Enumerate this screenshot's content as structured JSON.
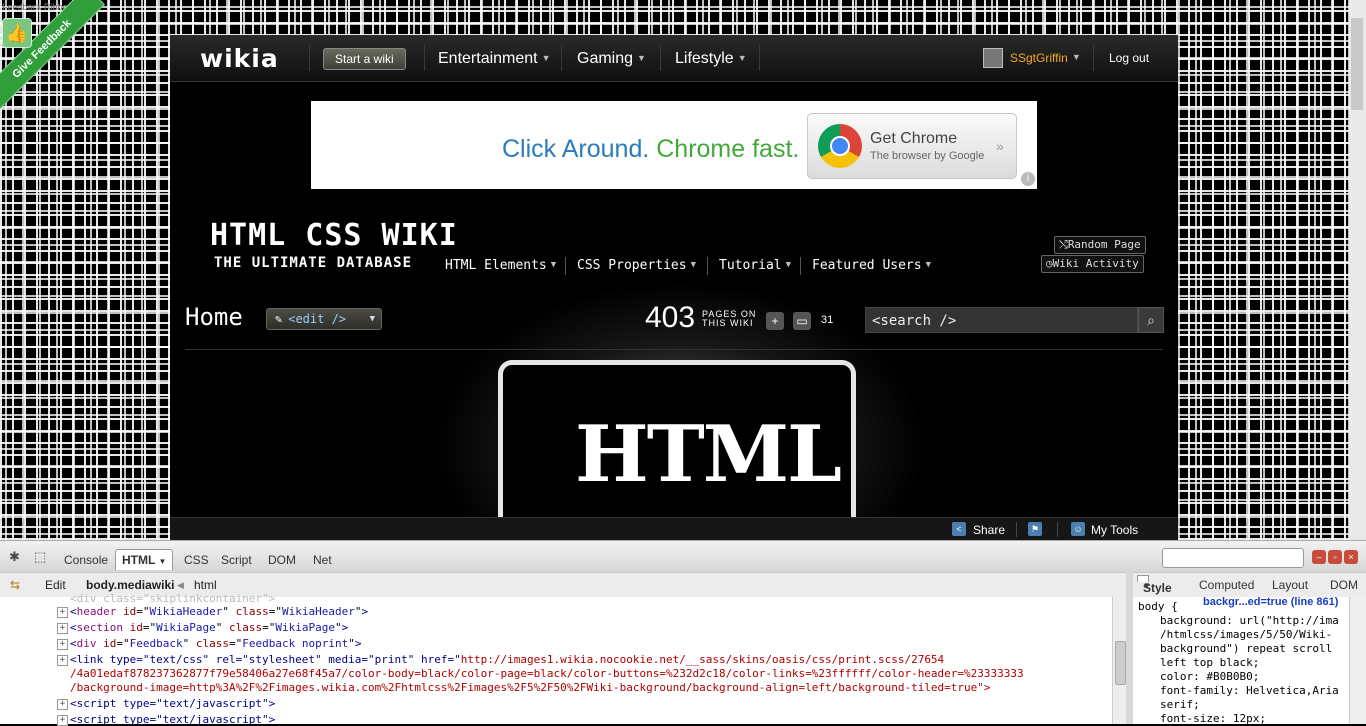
{
  "feedback": {
    "tooltip": "Feedback Ribbon",
    "ribbon_label": "Give Feedback"
  },
  "globalnav": {
    "logo": "wikia",
    "start_wiki": "Start a wiki",
    "hubs": [
      "Entertainment",
      "Gaming",
      "Lifestyle"
    ],
    "username": "SSgtGriffin",
    "logout": "Log out"
  },
  "ad": {
    "headline_part1": "Click Around.",
    "headline_part2": "Chrome fast.",
    "button_title": "Get Chrome",
    "button_subtitle": "The browser by Google",
    "button_arrow": "»",
    "info": "i"
  },
  "wiki": {
    "title": "HTML CSS WIKI",
    "subtitle": "THE ULTIMATE DATABASE",
    "nav": [
      "HTML Elements",
      "CSS Properties",
      "Tutorial",
      "Featured Users"
    ],
    "random_page": "Random Page",
    "wiki_activity": "Wiki Activity"
  },
  "header": {
    "page_title": "Home",
    "edit_label": "<edit />",
    "page_count": "403",
    "pages_label_1": "PAGES ON",
    "pages_label_2": "THIS WIKI",
    "comment_count": "31",
    "search_placeholder": "<search />"
  },
  "logo_image": {
    "text": "HTML"
  },
  "toolbar": {
    "share": "Share",
    "my_tools": "My Tools"
  },
  "firebug": {
    "tabs": [
      "Console",
      "HTML",
      "CSS",
      "Script",
      "DOM",
      "Net"
    ],
    "active_tab": "HTML",
    "path": {
      "edit": "Edit",
      "body": "body.mediawiki",
      "html": "html"
    },
    "side_tabs": [
      "Style",
      "Computed",
      "Layout",
      "DOM"
    ],
    "active_side_tab": "Style",
    "html_lines": [
      {
        "tag": "header",
        "attrs": [
          [
            "id",
            "WikiaHeader"
          ],
          [
            "class",
            "WikiaHeader"
          ]
        ]
      },
      {
        "tag": "section",
        "attrs": [
          [
            "id",
            "WikiaPage"
          ],
          [
            "class",
            "WikiaPage"
          ]
        ]
      },
      {
        "tag": "div",
        "attrs": [
          [
            "id",
            "Feedback"
          ],
          [
            "class",
            "Feedback noprint"
          ]
        ]
      }
    ],
    "link_line": {
      "prefix": "<link type=\"text/css\" rel=\"stylesheet\" media=\"print\" href=\"",
      "url1": "http://images1.wikia.nocookie.net/__sass/skins/oasis/css/print.scss/27654",
      "url2": "/4a01edaf878237362877f79e58406a27e68f45a7/color-body=black/color-page=black/color-buttons=%232d2c18/color-links=%23ffffff/color-header=%23333333",
      "url3": "/background-image=http%3A%2F%2Fimages.wikia.com%2Fhtmlcss%2Fimages%2F5%2F50%2FWiki-background/background-align=left/background-tiled=true\">"
    },
    "script_lines": [
      "<script type=\"text/javascript\">",
      "<script type=\"text/javascript\">"
    ],
    "css_rule": {
      "selector": "body {",
      "source": "backgr...ed=true (line 861)",
      "decl1": "background: url(\"http://ima",
      "decl1b": "/htmlcss/images/5/50/Wiki-",
      "decl1c": "background\") repeat scroll",
      "decl1d": "left top black;",
      "decl2": "color: #B0B0B0;",
      "decl3": "font-family: Helvetica,Aria",
      "decl3b": "serif;",
      "decl4": "font-size: 12px;"
    }
  },
  "colors": {
    "username": "#f5a623",
    "ribbon": "#2f9e3b",
    "ad_blue": "#2a7bbf",
    "ad_green": "#44a83a"
  }
}
